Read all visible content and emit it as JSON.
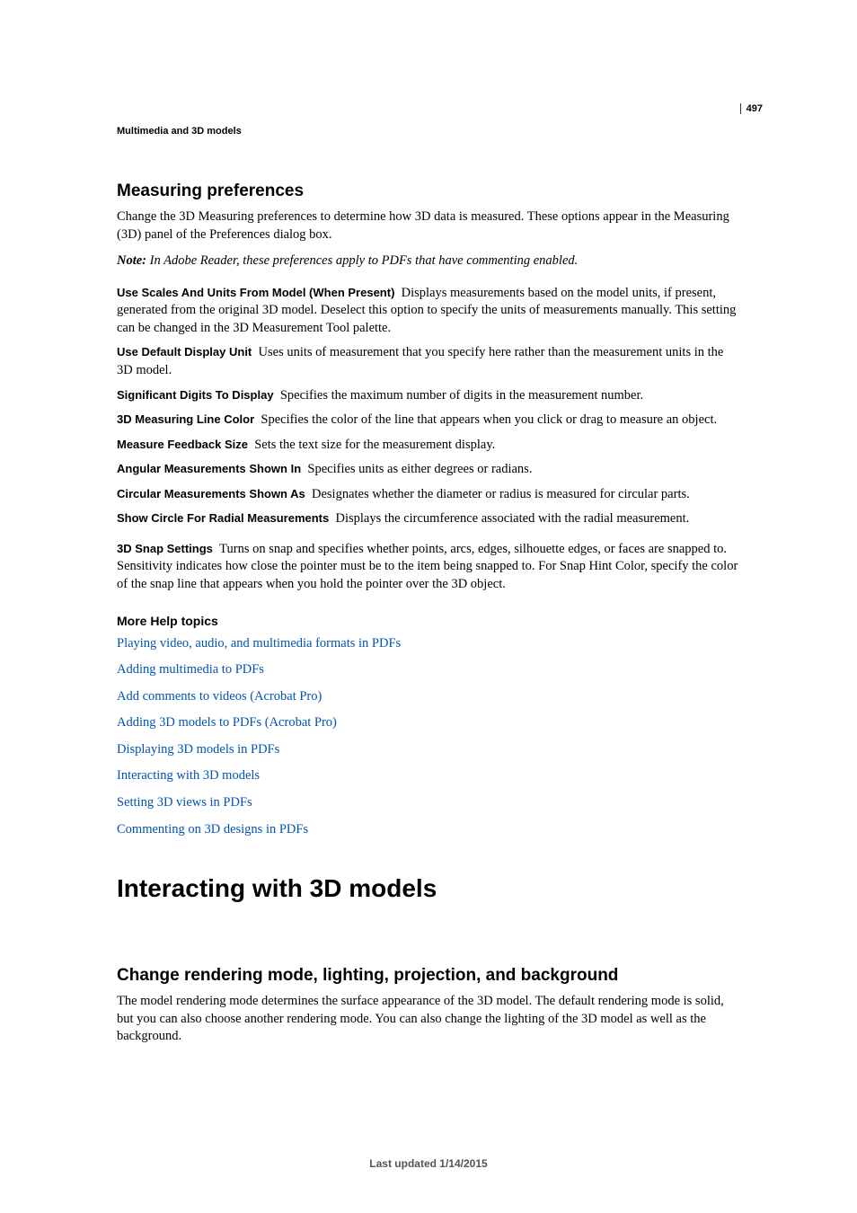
{
  "page_number": "497",
  "running_header": "Multimedia and 3D models",
  "section1": {
    "title": "Measuring preferences",
    "intro": "Change the 3D Measuring preferences to determine how 3D data is measured. These options appear in the Measuring (3D) panel of the Preferences dialog box.",
    "note_label": "Note:",
    "note": " In Adobe Reader, these preferences apply to PDFs that have commenting enabled.",
    "defs": [
      {
        "term": "Use Scales And Units From Model (When Present)",
        "desc": "Displays measurements based on the model units, if present, generated from the original 3D model. Deselect this option to specify the units of measurements manually. This setting can be changed in the 3D Measurement Tool palette."
      },
      {
        "term": "Use Default Display Unit",
        "desc": "Uses units of measurement that you specify here rather than the measurement units in the 3D model."
      },
      {
        "term": "Significant Digits To Display",
        "desc": "Specifies the maximum number of digits in the measurement number."
      },
      {
        "term": "3D Measuring Line Color",
        "desc": "Specifies the color of the line that appears when you click or drag to measure an object."
      },
      {
        "term": "Measure Feedback Size",
        "desc": "Sets the text size for the measurement display."
      },
      {
        "term": "Angular Measurements Shown In",
        "desc": "Specifies units as either degrees or radians."
      },
      {
        "term": "Circular Measurements Shown As",
        "desc": "Designates whether the diameter or radius is measured for circular parts."
      },
      {
        "term": "Show Circle For Radial Measurements",
        "desc": "Displays the circumference associated with the radial measurement."
      },
      {
        "term": "3D Snap Settings",
        "desc": "Turns on snap and specifies whether points, arcs, edges, silhouette edges, or faces are snapped to. Sensitivity indicates how close the pointer must be to the item being snapped to. For Snap Hint Color, specify the color of the snap line that appears when you hold the pointer over the 3D object."
      }
    ]
  },
  "more_help": {
    "title": "More Help topics",
    "links": [
      "Playing video, audio, and multimedia formats in PDFs",
      "Adding multimedia to PDFs",
      "Add comments to videos (Acrobat Pro)",
      "Adding 3D models to PDFs (Acrobat Pro)",
      "Displaying 3D models in PDFs",
      "Interacting with 3D models",
      "Setting 3D views in PDFs",
      "Commenting on 3D designs in PDFs"
    ]
  },
  "chapter_title": "Interacting with 3D models",
  "section2": {
    "title": "Change rendering mode, lighting, projection, and background",
    "body": "The model rendering mode determines the surface appearance of the 3D model. The default rendering mode is solid, but you can also choose another rendering mode. You can also change the lighting of the 3D model as well as the background."
  },
  "last_updated": "Last updated 1/14/2015"
}
